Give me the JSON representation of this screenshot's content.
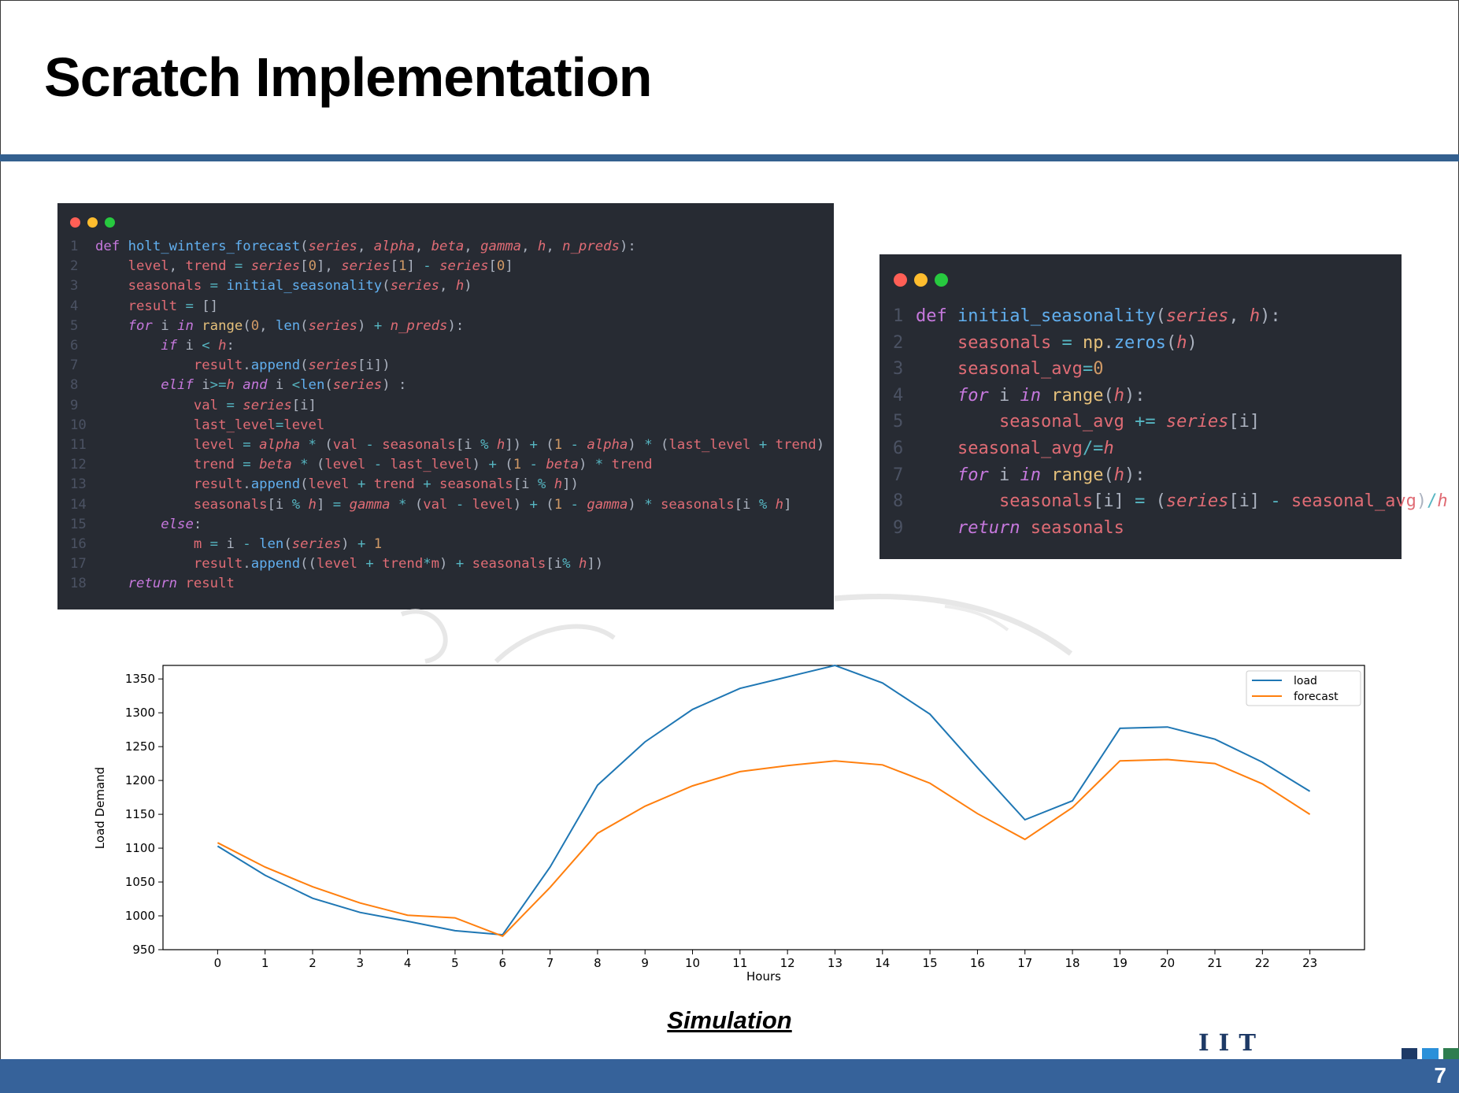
{
  "slide": {
    "title": "Scratch Implementation",
    "caption": "Simulation",
    "logo_text": "I I T ROORKEE",
    "page_number": "7"
  },
  "window_dot_colors": [
    "#ff5f56",
    "#ffbd2e",
    "#27c93f"
  ],
  "code_main": [
    [
      [
        "kw",
        "def "
      ],
      [
        "fn",
        "holt_winters_forecast"
      ],
      [
        "pl",
        "("
      ],
      [
        "it",
        "series"
      ],
      [
        "pl",
        ", "
      ],
      [
        "it",
        "alpha"
      ],
      [
        "pl",
        ", "
      ],
      [
        "it",
        "beta"
      ],
      [
        "pl",
        ", "
      ],
      [
        "it",
        "gamma"
      ],
      [
        "pl",
        ", "
      ],
      [
        "it",
        "h"
      ],
      [
        "pl",
        ", "
      ],
      [
        "it",
        "n_preds"
      ],
      [
        "pl",
        "):"
      ]
    ],
    [
      [
        "pl",
        "    "
      ],
      [
        "var",
        "level"
      ],
      [
        "pl",
        ", "
      ],
      [
        "var",
        "trend"
      ],
      [
        "op",
        " = "
      ],
      [
        "it",
        "series"
      ],
      [
        "pl",
        "["
      ],
      [
        "num",
        "0"
      ],
      [
        "pl",
        "], "
      ],
      [
        "it",
        "series"
      ],
      [
        "pl",
        "["
      ],
      [
        "num",
        "1"
      ],
      [
        "pl",
        "] "
      ],
      [
        "op",
        "-"
      ],
      [
        "pl",
        " "
      ],
      [
        "it",
        "series"
      ],
      [
        "pl",
        "["
      ],
      [
        "num",
        "0"
      ],
      [
        "pl",
        "]"
      ]
    ],
    [
      [
        "pl",
        "    "
      ],
      [
        "var",
        "seasonals"
      ],
      [
        "op",
        " = "
      ],
      [
        "fn",
        "initial_seasonality"
      ],
      [
        "pl",
        "("
      ],
      [
        "it",
        "series"
      ],
      [
        "pl",
        ", "
      ],
      [
        "it",
        "h"
      ],
      [
        "pl",
        ")"
      ]
    ],
    [
      [
        "pl",
        "    "
      ],
      [
        "var",
        "result"
      ],
      [
        "op",
        " = "
      ],
      [
        "pl",
        "[]"
      ]
    ],
    [
      [
        "pl",
        "    "
      ],
      [
        "kwi",
        "for"
      ],
      [
        "pl",
        " i "
      ],
      [
        "kwi",
        "in"
      ],
      [
        "pl",
        " "
      ],
      [
        "bi",
        "range"
      ],
      [
        "pl",
        "("
      ],
      [
        "num",
        "0"
      ],
      [
        "pl",
        ", "
      ],
      [
        "fn",
        "len"
      ],
      [
        "pl",
        "("
      ],
      [
        "it",
        "series"
      ],
      [
        "pl",
        ") "
      ],
      [
        "op",
        "+"
      ],
      [
        "pl",
        " "
      ],
      [
        "it",
        "n_preds"
      ],
      [
        "pl",
        "):"
      ]
    ],
    [
      [
        "pl",
        "        "
      ],
      [
        "kwi",
        "if"
      ],
      [
        "pl",
        " i "
      ],
      [
        "op",
        "<"
      ],
      [
        "pl",
        " "
      ],
      [
        "it",
        "h"
      ],
      [
        "pl",
        ":"
      ]
    ],
    [
      [
        "pl",
        "            "
      ],
      [
        "var",
        "result"
      ],
      [
        "pl",
        "."
      ],
      [
        "fn",
        "append"
      ],
      [
        "pl",
        "("
      ],
      [
        "it",
        "series"
      ],
      [
        "pl",
        "[i])"
      ]
    ],
    [
      [
        "pl",
        "        "
      ],
      [
        "kwi",
        "elif"
      ],
      [
        "pl",
        " i"
      ],
      [
        "op",
        ">="
      ],
      [
        "it",
        "h"
      ],
      [
        "pl",
        " "
      ],
      [
        "kwi",
        "and"
      ],
      [
        "pl",
        " i "
      ],
      [
        "op",
        "<"
      ],
      [
        "fn",
        "len"
      ],
      [
        "pl",
        "("
      ],
      [
        "it",
        "series"
      ],
      [
        "pl",
        ") :"
      ]
    ],
    [
      [
        "pl",
        "            "
      ],
      [
        "var",
        "val"
      ],
      [
        "op",
        " = "
      ],
      [
        "it",
        "series"
      ],
      [
        "pl",
        "[i]"
      ]
    ],
    [
      [
        "pl",
        "            "
      ],
      [
        "var",
        "last_level"
      ],
      [
        "op",
        "="
      ],
      [
        "var",
        "level"
      ]
    ],
    [
      [
        "pl",
        "            "
      ],
      [
        "var",
        "level"
      ],
      [
        "op",
        " = "
      ],
      [
        "it",
        "alpha"
      ],
      [
        "op",
        " * "
      ],
      [
        "pl",
        "("
      ],
      [
        "var",
        "val"
      ],
      [
        "op",
        " - "
      ],
      [
        "var",
        "seasonals"
      ],
      [
        "pl",
        "[i "
      ],
      [
        "op",
        "%"
      ],
      [
        "pl",
        " "
      ],
      [
        "it",
        "h"
      ],
      [
        "pl",
        "]) "
      ],
      [
        "op",
        "+"
      ],
      [
        "pl",
        " ("
      ],
      [
        "num",
        "1"
      ],
      [
        "op",
        " - "
      ],
      [
        "it",
        "alpha"
      ],
      [
        "pl",
        ") "
      ],
      [
        "op",
        "*"
      ],
      [
        "pl",
        " ("
      ],
      [
        "var",
        "last_level"
      ],
      [
        "op",
        " + "
      ],
      [
        "var",
        "trend"
      ],
      [
        "pl",
        ")"
      ]
    ],
    [
      [
        "pl",
        "            "
      ],
      [
        "var",
        "trend"
      ],
      [
        "op",
        " = "
      ],
      [
        "it",
        "beta"
      ],
      [
        "op",
        " * "
      ],
      [
        "pl",
        "("
      ],
      [
        "var",
        "level"
      ],
      [
        "op",
        " - "
      ],
      [
        "var",
        "last_level"
      ],
      [
        "pl",
        ") "
      ],
      [
        "op",
        "+"
      ],
      [
        "pl",
        " ("
      ],
      [
        "num",
        "1"
      ],
      [
        "op",
        " - "
      ],
      [
        "it",
        "beta"
      ],
      [
        "pl",
        ") "
      ],
      [
        "op",
        "*"
      ],
      [
        "pl",
        " "
      ],
      [
        "var",
        "trend"
      ]
    ],
    [
      [
        "pl",
        "            "
      ],
      [
        "var",
        "result"
      ],
      [
        "pl",
        "."
      ],
      [
        "fn",
        "append"
      ],
      [
        "pl",
        "("
      ],
      [
        "var",
        "level"
      ],
      [
        "op",
        " + "
      ],
      [
        "var",
        "trend"
      ],
      [
        "op",
        " + "
      ],
      [
        "var",
        "seasonals"
      ],
      [
        "pl",
        "[i "
      ],
      [
        "op",
        "%"
      ],
      [
        "pl",
        " "
      ],
      [
        "it",
        "h"
      ],
      [
        "pl",
        "])"
      ]
    ],
    [
      [
        "pl",
        "            "
      ],
      [
        "var",
        "seasonals"
      ],
      [
        "pl",
        "[i "
      ],
      [
        "op",
        "%"
      ],
      [
        "pl",
        " "
      ],
      [
        "it",
        "h"
      ],
      [
        "pl",
        "] "
      ],
      [
        "op",
        "="
      ],
      [
        "pl",
        " "
      ],
      [
        "it",
        "gamma"
      ],
      [
        "op",
        " * "
      ],
      [
        "pl",
        "("
      ],
      [
        "var",
        "val"
      ],
      [
        "op",
        " - "
      ],
      [
        "var",
        "level"
      ],
      [
        "pl",
        ") "
      ],
      [
        "op",
        "+"
      ],
      [
        "pl",
        " ("
      ],
      [
        "num",
        "1"
      ],
      [
        "op",
        " - "
      ],
      [
        "it",
        "gamma"
      ],
      [
        "pl",
        ") "
      ],
      [
        "op",
        "*"
      ],
      [
        "pl",
        " "
      ],
      [
        "var",
        "seasonals"
      ],
      [
        "pl",
        "[i "
      ],
      [
        "op",
        "%"
      ],
      [
        "pl",
        " "
      ],
      [
        "it",
        "h"
      ],
      [
        "pl",
        "]"
      ]
    ],
    [
      [
        "pl",
        "        "
      ],
      [
        "kwi",
        "else"
      ],
      [
        "pl",
        ":"
      ]
    ],
    [
      [
        "pl",
        "            "
      ],
      [
        "var",
        "m"
      ],
      [
        "op",
        " = "
      ],
      [
        "pl",
        "i "
      ],
      [
        "op",
        "-"
      ],
      [
        "pl",
        " "
      ],
      [
        "fn",
        "len"
      ],
      [
        "pl",
        "("
      ],
      [
        "it",
        "series"
      ],
      [
        "pl",
        ") "
      ],
      [
        "op",
        "+"
      ],
      [
        "pl",
        " "
      ],
      [
        "num",
        "1"
      ]
    ],
    [
      [
        "pl",
        "            "
      ],
      [
        "var",
        "result"
      ],
      [
        "pl",
        "."
      ],
      [
        "fn",
        "append"
      ],
      [
        "pl",
        "(("
      ],
      [
        "var",
        "level"
      ],
      [
        "op",
        " + "
      ],
      [
        "var",
        "trend"
      ],
      [
        "op",
        "*"
      ],
      [
        "var",
        "m"
      ],
      [
        "pl",
        ") "
      ],
      [
        "op",
        "+"
      ],
      [
        "pl",
        " "
      ],
      [
        "var",
        "seasonals"
      ],
      [
        "pl",
        "[i"
      ],
      [
        "op",
        "%"
      ],
      [
        "pl",
        " "
      ],
      [
        "it",
        "h"
      ],
      [
        "pl",
        "])"
      ]
    ],
    [
      [
        "pl",
        "    "
      ],
      [
        "kwi",
        "return"
      ],
      [
        "pl",
        " "
      ],
      [
        "var",
        "result"
      ]
    ]
  ],
  "code_init": [
    [
      [
        "kw",
        "def "
      ],
      [
        "fn",
        "initial_seasonality"
      ],
      [
        "pl",
        "("
      ],
      [
        "it",
        "series"
      ],
      [
        "pl",
        ", "
      ],
      [
        "it",
        "h"
      ],
      [
        "pl",
        "):"
      ]
    ],
    [
      [
        "pl",
        "    "
      ],
      [
        "var",
        "seasonals"
      ],
      [
        "op",
        " = "
      ],
      [
        "bi",
        "np"
      ],
      [
        "pl",
        "."
      ],
      [
        "fn",
        "zeros"
      ],
      [
        "pl",
        "("
      ],
      [
        "it",
        "h"
      ],
      [
        "pl",
        ")"
      ]
    ],
    [
      [
        "pl",
        "    "
      ],
      [
        "var",
        "seasonal_avg"
      ],
      [
        "op",
        "="
      ],
      [
        "num",
        "0"
      ]
    ],
    [
      [
        "pl",
        "    "
      ],
      [
        "kwi",
        "for"
      ],
      [
        "pl",
        " i "
      ],
      [
        "kwi",
        "in"
      ],
      [
        "pl",
        " "
      ],
      [
        "bi",
        "range"
      ],
      [
        "pl",
        "("
      ],
      [
        "it",
        "h"
      ],
      [
        "pl",
        "):"
      ]
    ],
    [
      [
        "pl",
        "        "
      ],
      [
        "var",
        "seasonal_avg"
      ],
      [
        "op",
        " += "
      ],
      [
        "it",
        "series"
      ],
      [
        "pl",
        "[i]"
      ]
    ],
    [
      [
        "pl",
        "    "
      ],
      [
        "var",
        "seasonal_avg"
      ],
      [
        "op",
        "/="
      ],
      [
        "it",
        "h"
      ]
    ],
    [
      [
        "pl",
        "    "
      ],
      [
        "kwi",
        "for"
      ],
      [
        "pl",
        " i "
      ],
      [
        "kwi",
        "in"
      ],
      [
        "pl",
        " "
      ],
      [
        "bi",
        "range"
      ],
      [
        "pl",
        "("
      ],
      [
        "it",
        "h"
      ],
      [
        "pl",
        "):"
      ]
    ],
    [
      [
        "pl",
        "        "
      ],
      [
        "var",
        "seasonals"
      ],
      [
        "pl",
        "[i] "
      ],
      [
        "op",
        "="
      ],
      [
        "pl",
        " ("
      ],
      [
        "it",
        "series"
      ],
      [
        "pl",
        "[i] "
      ],
      [
        "op",
        "-"
      ],
      [
        "pl",
        " "
      ],
      [
        "var",
        "seasonal_avg"
      ],
      [
        "pl",
        ")"
      ],
      [
        "op",
        "/"
      ],
      [
        "it",
        "h"
      ]
    ],
    [
      [
        "pl",
        "    "
      ],
      [
        "kwi",
        "return"
      ],
      [
        "pl",
        " "
      ],
      [
        "var",
        "seasonals"
      ]
    ]
  ],
  "chart_data": {
    "type": "line",
    "title": "",
    "xlabel": "Hours",
    "ylabel": "Load Demand",
    "x": [
      0,
      1,
      2,
      3,
      4,
      5,
      6,
      7,
      8,
      9,
      10,
      11,
      12,
      13,
      14,
      15,
      16,
      17,
      18,
      19,
      20,
      21,
      22,
      23
    ],
    "ylim": [
      950,
      1370
    ],
    "xlim": [
      -1.15,
      24.15
    ],
    "yticks": [
      950,
      1000,
      1050,
      1100,
      1150,
      1200,
      1250,
      1300,
      1350
    ],
    "grid": false,
    "legend_position": "top-right",
    "series": [
      {
        "name": "load",
        "color": "#1f77b4",
        "values": [
          1103,
          1060,
          1026,
          1005,
          992,
          978,
          972,
          1072,
          1193,
          1257,
          1305,
          1336,
          1353,
          1370,
          1344,
          1298,
          1219,
          1142,
          1170,
          1277,
          1279,
          1261,
          1227,
          1184
        ]
      },
      {
        "name": "forecast",
        "color": "#ff7f0e",
        "values": [
          1108,
          1072,
          1043,
          1019,
          1001,
          997,
          970,
          1042,
          1122,
          1162,
          1192,
          1213,
          1222,
          1229,
          1223,
          1196,
          1151,
          1113,
          1160,
          1229,
          1231,
          1225,
          1195,
          1150
        ]
      }
    ]
  }
}
